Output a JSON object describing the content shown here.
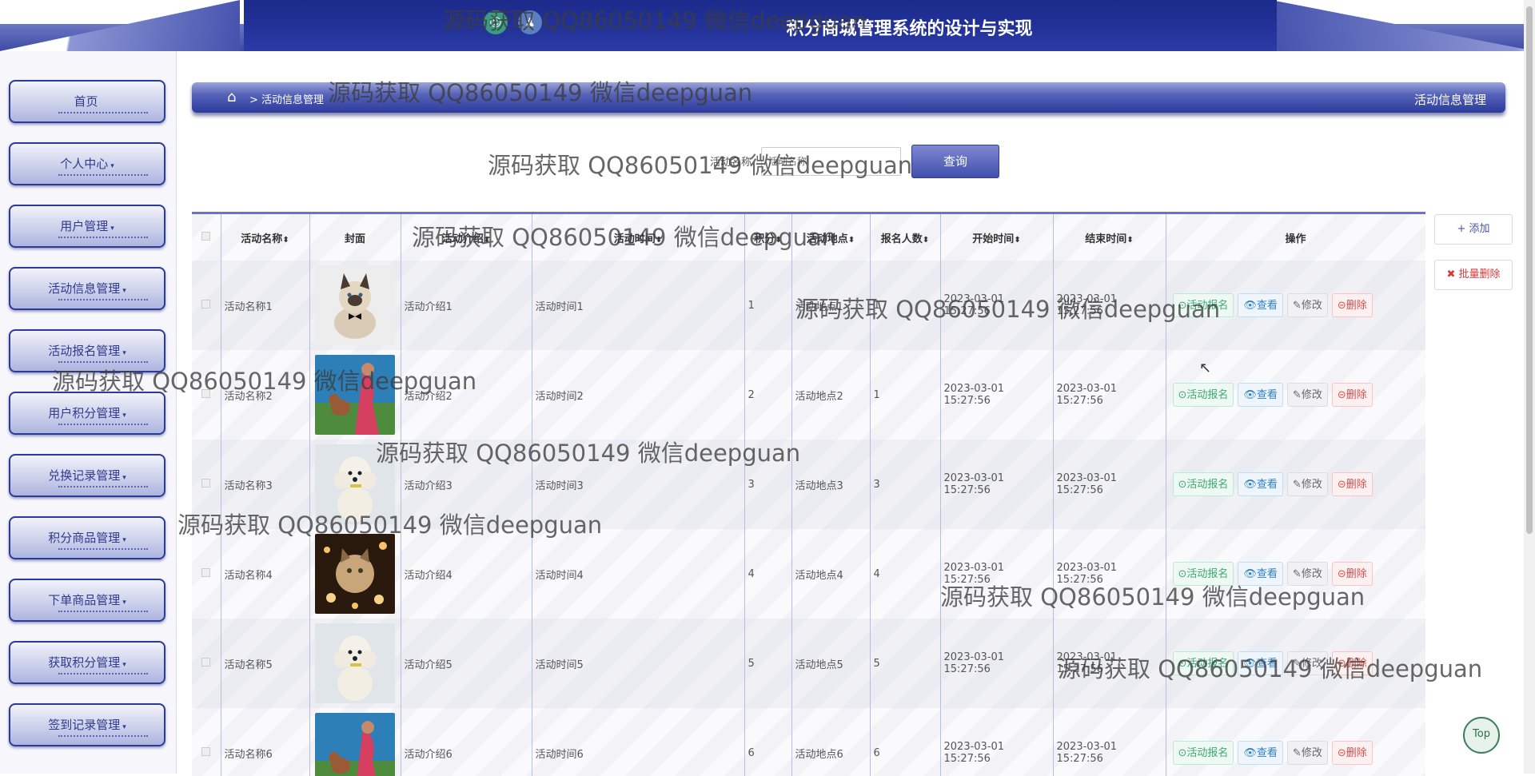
{
  "header": {
    "title": "积分商城管理系统的设计与实现",
    "icon_a": "☺",
    "icon_b": "♟"
  },
  "sidebar": {
    "items": [
      {
        "label": "首页",
        "caret": ""
      },
      {
        "label": "个人中心",
        "caret": "▾"
      },
      {
        "label": "用户管理",
        "caret": "▾"
      },
      {
        "label": "活动信息管理",
        "caret": "▾"
      },
      {
        "label": "活动报名管理",
        "caret": "▾"
      },
      {
        "label": "用户积分管理",
        "caret": "▾"
      },
      {
        "label": "兑换记录管理",
        "caret": "▾"
      },
      {
        "label": "积分商品管理",
        "caret": "▾"
      },
      {
        "label": "下单商品管理",
        "caret": "▾"
      },
      {
        "label": "获取积分管理",
        "caret": "▾"
      },
      {
        "label": "签到记录管理",
        "caret": "▾"
      }
    ]
  },
  "breadcrumb": {
    "home_icon": "⌂",
    "path": "> 活动信息管理",
    "current": "活动信息管理"
  },
  "search": {
    "label": "活动名称",
    "placeholder": "活动名称",
    "button": "查询"
  },
  "table": {
    "columns": [
      "活动名称",
      "封面",
      "活动介绍",
      "活动时间",
      "积分",
      "活动地点",
      "报名人数",
      "开始时间",
      "结束时间",
      "操作"
    ],
    "sort_glyph": "⬍",
    "rows": [
      {
        "name": "活动名称1",
        "cover": "cat",
        "intro": "活动介绍1",
        "time": "活动时间1",
        "points": "1",
        "place": "活动地点1",
        "count": "1",
        "start": "2023-03-01 15:27:56",
        "end": "2023-03-01 15:27:56"
      },
      {
        "name": "活动名称2",
        "cover": "dog-girl",
        "intro": "活动介绍2",
        "time": "活动时间2",
        "points": "2",
        "place": "活动地点2",
        "count": "1",
        "start": "2023-03-01 15:27:56",
        "end": "2023-03-01 15:27:56"
      },
      {
        "name": "活动名称3",
        "cover": "poodle",
        "intro": "活动介绍3",
        "time": "活动时间3",
        "points": "3",
        "place": "活动地点3",
        "count": "3",
        "start": "2023-03-01 15:27:56",
        "end": "2023-03-01 15:27:56"
      },
      {
        "name": "活动名称4",
        "cover": "cat-lights",
        "intro": "活动介绍4",
        "time": "活动时间4",
        "points": "4",
        "place": "活动地点4",
        "count": "4",
        "start": "2023-03-01 15:27:56",
        "end": "2023-03-01 15:27:56"
      },
      {
        "name": "活动名称5",
        "cover": "poodle",
        "intro": "活动介绍5",
        "time": "活动时间5",
        "points": "5",
        "place": "活动地点5",
        "count": "5",
        "start": "2023-03-01 15:27:56",
        "end": "2023-03-01 15:27:56"
      },
      {
        "name": "活动名称6",
        "cover": "dog-girl",
        "intro": "活动介绍6",
        "time": "活动时间6",
        "points": "6",
        "place": "活动地点6",
        "count": "6",
        "start": "2023-03-01 15:27:56",
        "end": "2023-03-01 15:27:56"
      }
    ],
    "ops": {
      "signup": "⊙活动报名",
      "view": "👁查看",
      "edit": "✎修改",
      "del": "⊝删除"
    }
  },
  "actions": {
    "add": "+ 添加",
    "batch_delete": "✖ 批量删除",
    "top": "Top"
  },
  "watermark": "源码获取 QQ86050149 微信deepguan"
}
